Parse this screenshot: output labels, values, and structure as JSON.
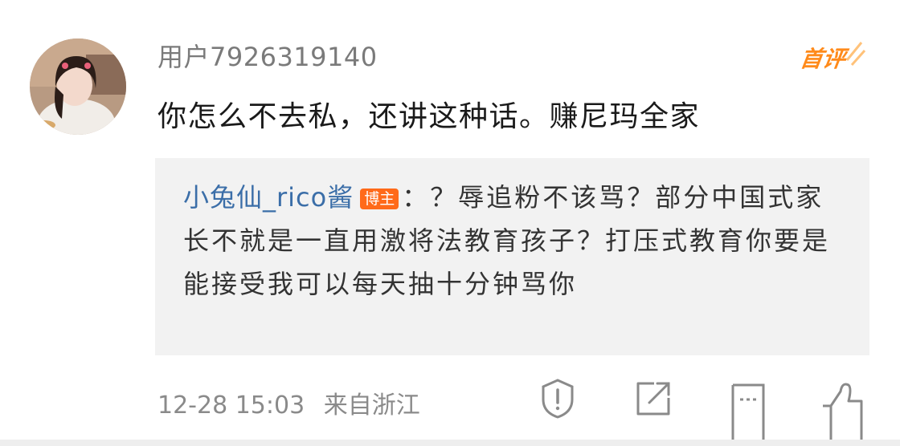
{
  "comment": {
    "username": "用户7926319140",
    "badge": "首评",
    "text": "你怎么不去私，还讲这种话。赚尼玛全家"
  },
  "reply": {
    "author": "小兔仙_rico酱",
    "author_tag": "博主",
    "text": "：？辱追粉不该骂？部分中国式家长不就是一直用激将法教育孩子？打压式教育你要是能接受我可以每天抽十分钟骂你"
  },
  "meta": {
    "timestamp": "12-28 15:03",
    "location": "来自浙江"
  },
  "actions": [
    "report-icon",
    "share-icon",
    "comment-icon",
    "like-icon"
  ],
  "colors": {
    "username": "#7a7a7a",
    "reply_author": "#3b6ea8",
    "badge": "#ff8a1a",
    "blogger_tag": "#ff6a1a",
    "reply_bg": "#f2f2f2"
  }
}
